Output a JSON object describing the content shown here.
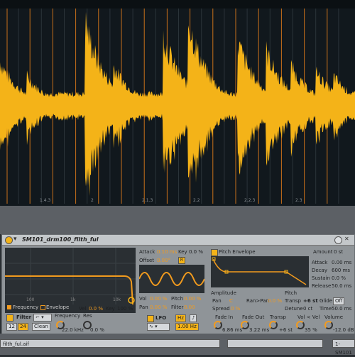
{
  "colors": {
    "waveform": "#f4b318",
    "accent": "#f29b1e",
    "background": "#11181d"
  },
  "timeline": {
    "bar_labels": [
      "1.4.3",
      "2",
      "2.1.3",
      "2.2",
      "2.2.3",
      "2.3"
    ]
  },
  "device": {
    "title": "SM101_drm100_filth_ful",
    "filter_graph": {
      "freq_labels": [
        "100",
        "1k",
        "10k"
      ],
      "legend_frequency": "Frequency",
      "legend_envelope": "Envelope"
    },
    "filter": {
      "label": "Filter",
      "type_options_selected": "Clean",
      "slope_12": "12",
      "slope_24": "24",
      "frequency_label": "Frequency",
      "frequency_value": "22.0 kHz",
      "res_label": "Res",
      "res_value": "0.0 %",
      "vel_label": "Vel",
      "vel_value": "0.0 %",
      "key_label": "Key",
      "key_value": "100 %"
    },
    "lfo": {
      "attack_label": "Attack",
      "attack_value": "0.10 ms",
      "key_label": "Key",
      "key_value": "0.0 %",
      "offset_label": "Offset",
      "offset_value": "0.00°",
      "r_label": "R",
      "vol_label": "Vol",
      "vol_value": "0.00 %",
      "pitch_label": "Pitch",
      "pitch_value": "0.00 %",
      "pan_label": "Pan",
      "pan_value": "0.00 %",
      "filter_label": "Filter",
      "filter_value": "0.00",
      "label": "LFO",
      "hz_label": "Hz",
      "note_label": "♪",
      "rate_value": "1.00 Hz"
    },
    "pitch_env": {
      "label": "Pitch Envelope",
      "amount_label": "Amount",
      "amount_value": "0 st",
      "attack_label": "Attack",
      "attack_value": "0.00 ms",
      "decay_label": "Decay",
      "decay_value": "600 ms",
      "sustain_label": "Sustain",
      "sustain_value": "0.0 %",
      "release_label": "Release",
      "release_value": "50.0 ms"
    },
    "amplitude": {
      "label": "Amplitude",
      "pan_label": "Pan",
      "pan_value": "C",
      "ranpan_label": "Ran>Pan",
      "ranpan_value": "0.0 %",
      "spread_label": "Spread",
      "spread_value": "0 %"
    },
    "pitch": {
      "label": "Pitch",
      "transp_label": "Transp",
      "transp_value": "+6 st",
      "detune_label": "Detune",
      "detune_value": "0 ct",
      "glide_label": "Glide",
      "glide_value": "Off",
      "time_label": "Time",
      "time_value": "50.0 ms"
    },
    "bottom": {
      "fade_in_label": "Fade In",
      "fade_in_value": "6.86 ms",
      "fade_out_label": "Fade Out",
      "fade_out_value": "3.22 ms",
      "transp_label": "Transp",
      "transp_value": "+6 st",
      "vol_vel_label": "Vol < Vel",
      "vol_vel_value": "35 %",
      "volume_label": "Volume",
      "volume_value": "-12.0 dB"
    }
  },
  "status": {
    "file_name": "filth_ful.aif",
    "track_name": "1-SM101"
  }
}
